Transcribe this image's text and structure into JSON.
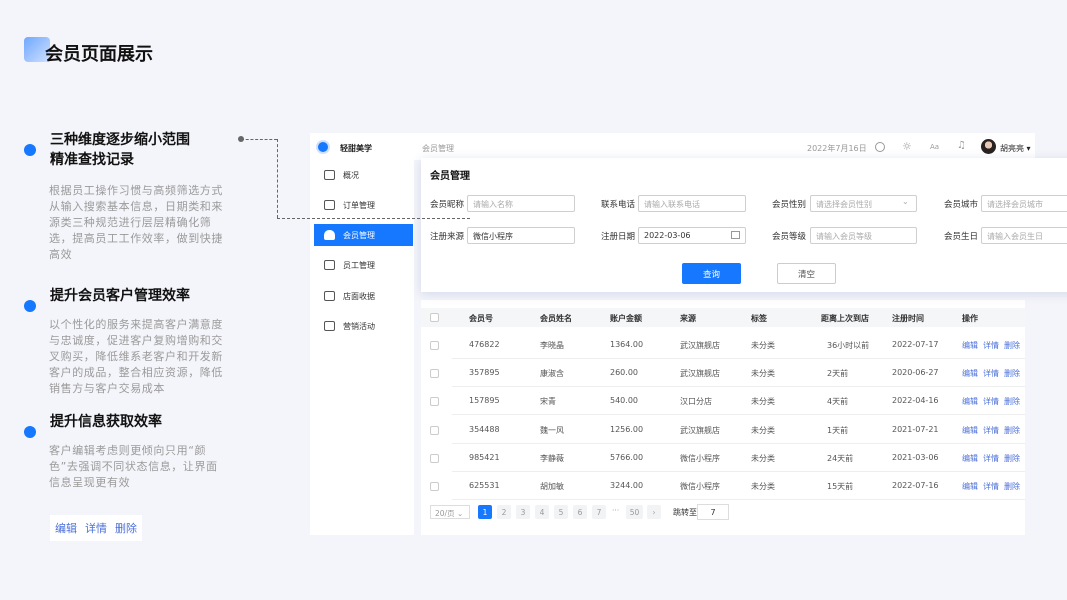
{
  "page_title": "会员页面展示",
  "features": [
    {
      "title_lines": [
        "三种维度逐步缩小范围",
        "精准查找记录"
      ],
      "body": "根据员工操作习惯与高频筛选方式从输入搜索基本信息，日期类和来源类三种规范进行层层精确化筛选，提高员工工作效率，做到快捷高效"
    },
    {
      "title_lines": [
        "提升会员客户管理效率"
      ],
      "body": "以个性化的服务来提高客户满意度与忠诚度，促进客户复购增购和交叉购买，降低维系老客户和开发新客户的成品，整合相应资源，降低销售方与客户交易成本"
    },
    {
      "title_lines": [
        "提升信息获取效率"
      ],
      "body": "客户编辑考虑则更倾向只用“颜色”去强调不同状态信息，让界面信息呈现更有效"
    }
  ],
  "ops_demo": [
    "编辑",
    "详情",
    "删除"
  ],
  "app": {
    "brand": "轻甜美学",
    "breadcrumb": "会员管理",
    "date": "2022年7月16日",
    "font_btn": "Aa",
    "user": "胡亮亮",
    "accent": "#1677ff",
    "nav": [
      "概况",
      "订单管理",
      "会员管理",
      "员工管理",
      "店面收据",
      "营销活动"
    ],
    "nav_active": 2
  },
  "filter": {
    "title": "会员管理",
    "fields": [
      {
        "label": "会员昵称",
        "placeholder": "请输入名称",
        "value": ""
      },
      {
        "label": "联系电话",
        "placeholder": "请输入联系电话",
        "value": ""
      },
      {
        "label": "会员性别",
        "placeholder": "请选择会员性别",
        "value": ""
      },
      {
        "label": "会员城市",
        "placeholder": "请选择会员城市",
        "value": ""
      },
      {
        "label": "注册来源",
        "placeholder": "",
        "value": "微信小程序"
      },
      {
        "label": "注册日期",
        "placeholder": "",
        "value": "2022-03-06"
      },
      {
        "label": "会员等级",
        "placeholder": "请输入会员等级",
        "value": ""
      },
      {
        "label": "会员生日",
        "placeholder": "请输入会员生日",
        "value": ""
      }
    ],
    "query": "查询",
    "clear": "清空"
  },
  "table": {
    "columns": [
      "会员号",
      "会员姓名",
      "账户金额",
      "来源",
      "标签",
      "距离上次到店",
      "注册时间",
      "操作"
    ],
    "rows": [
      [
        "476822",
        "李晓晶",
        "1364.00",
        "武汉旗舰店",
        "未分类",
        "36小时以前",
        "2022-07-17"
      ],
      [
        "357895",
        "康淑含",
        "260.00",
        "武汉旗舰店",
        "未分类",
        "2天前",
        "2020-06-27"
      ],
      [
        "157895",
        "宋青",
        "540.00",
        "汉口分店",
        "未分类",
        "4天前",
        "2022-04-16"
      ],
      [
        "354488",
        "魏一风",
        "1256.00",
        "武汉旗舰店",
        "未分类",
        "1天前",
        "2021-07-21"
      ],
      [
        "985421",
        "李静薇",
        "5766.00",
        "微信小程序",
        "未分类",
        "24天前",
        "2021-03-06"
      ],
      [
        "625531",
        "胡加敏",
        "3244.00",
        "微信小程序",
        "未分类",
        "15天前",
        "2022-07-16"
      ]
    ],
    "actions": [
      "编辑",
      "详情",
      "删除"
    ]
  },
  "pagination": {
    "page_size": "20/页",
    "pages": [
      "1",
      "2",
      "3",
      "4",
      "5",
      "6",
      "7"
    ],
    "ellipsis": "···",
    "last": "50",
    "next": "›",
    "current": 1,
    "jump_label": "跳转至",
    "jump_value": "7"
  }
}
